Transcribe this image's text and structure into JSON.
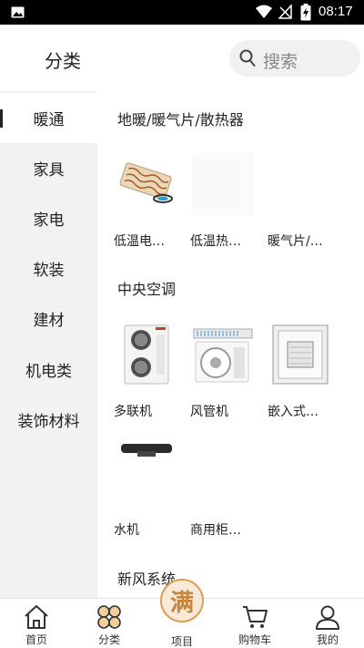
{
  "status_bar": {
    "time": "08:17",
    "icons": [
      "image-icon",
      "wifi-icon",
      "signal-off-icon",
      "battery-charging-icon"
    ]
  },
  "header": {
    "title": "分类",
    "search_placeholder": "搜索",
    "search_icon": "search-icon"
  },
  "sidebar": {
    "items": [
      {
        "label": "暖通",
        "active": true
      },
      {
        "label": "家具",
        "active": false
      },
      {
        "label": "家电",
        "active": false
      },
      {
        "label": "软装",
        "active": false
      },
      {
        "label": "建材",
        "active": false
      },
      {
        "label": "机电类",
        "active": false
      },
      {
        "label": "装饰材料",
        "active": false
      }
    ]
  },
  "content": {
    "sections": [
      {
        "title": "地暖/暖气片/散热器",
        "products": [
          "低温电…",
          "低温热…",
          "暖气片/…"
        ]
      },
      {
        "title": "中央空调",
        "products": [
          "多联机",
          "风管机",
          "嵌入式…",
          "水机",
          "商用柜…"
        ]
      },
      {
        "title": "新风系统",
        "products": []
      }
    ]
  },
  "tabbar": {
    "tabs": [
      {
        "label": "首页",
        "icon": "home-icon"
      },
      {
        "label": "分类",
        "icon": "category-icon"
      },
      {
        "label": "项目",
        "icon": "project-badge",
        "badge_text": "满"
      },
      {
        "label": "购物车",
        "icon": "cart-icon"
      },
      {
        "label": "我的",
        "icon": "user-icon"
      }
    ]
  },
  "colors": {
    "sidebar_bg": "#f2f2f2",
    "search_bg": "#f1f1f1",
    "badge_accent": "#d9a055"
  }
}
